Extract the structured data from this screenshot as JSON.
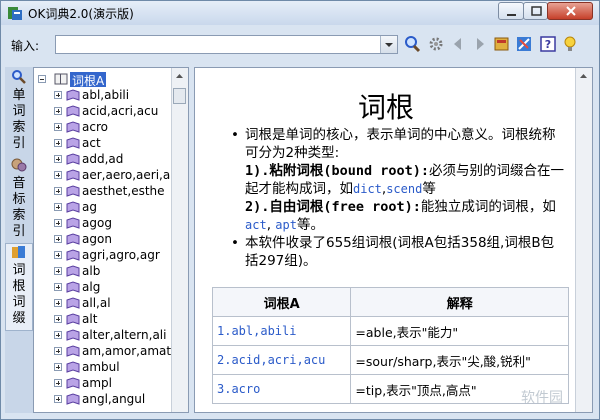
{
  "window": {
    "title": "OK词典2.0(演示版)"
  },
  "toolbar": {
    "input_label": "输入:",
    "input_value": ""
  },
  "side_tabs": [
    {
      "label": "单词索引",
      "icon": "magnifier-icon"
    },
    {
      "label": "音标索引",
      "icon": "bubbles-icon"
    },
    {
      "label": "词根词缀",
      "icon": "books-icon"
    }
  ],
  "tree": {
    "root": "词根A",
    "items": [
      "abl,abili",
      "acid,acri,acu",
      "acro",
      "act",
      "add,ad",
      "aer,aero,aeri,a",
      "aesthet,esthe",
      "ag",
      "agog",
      "agon",
      "agri,agro,agr",
      "alb",
      "alg",
      "all,al",
      "alt",
      "alter,altern,ali",
      "am,amor,amat",
      "ambul",
      "ampl",
      "angl,angul"
    ]
  },
  "content": {
    "title": "词根",
    "p1": "词根是单词的核心，表示单词的中心意义。词根统称可分为2种类型:",
    "p2_lead": "1).粘附词根(bound root):",
    "p2_text": "必须与别的词缀合在一起才能构成词，如",
    "p2_ex1": "dict",
    "p2_sep": ",",
    "p2_ex2": "scend",
    "p2_end": "等",
    "p3_lead": "2).自由词根(free root):",
    "p3_text": "能独立成词的词根，如",
    "p3_ex1": "act",
    "p3_sep": ", ",
    "p3_ex2": "apt",
    "p3_end": "等。",
    "p4": "本软件收录了655组词根(词根A包括358组,词根B包括297组)。",
    "table": {
      "headers": [
        "词根A",
        "解释"
      ],
      "rows": [
        [
          "1.abl,abili",
          "=able,表示\"能力\""
        ],
        [
          "2.acid,acri,acu",
          "=sour/sharp,表示\"尖,酸,锐利\""
        ],
        [
          "3.acro",
          "=tip,表示\"顶点,高点\""
        ]
      ]
    }
  },
  "watermark": "软件园",
  "colors": {
    "frame": "#d9e4f1",
    "selection": "#3366cc",
    "link": "#2b5bc9"
  }
}
